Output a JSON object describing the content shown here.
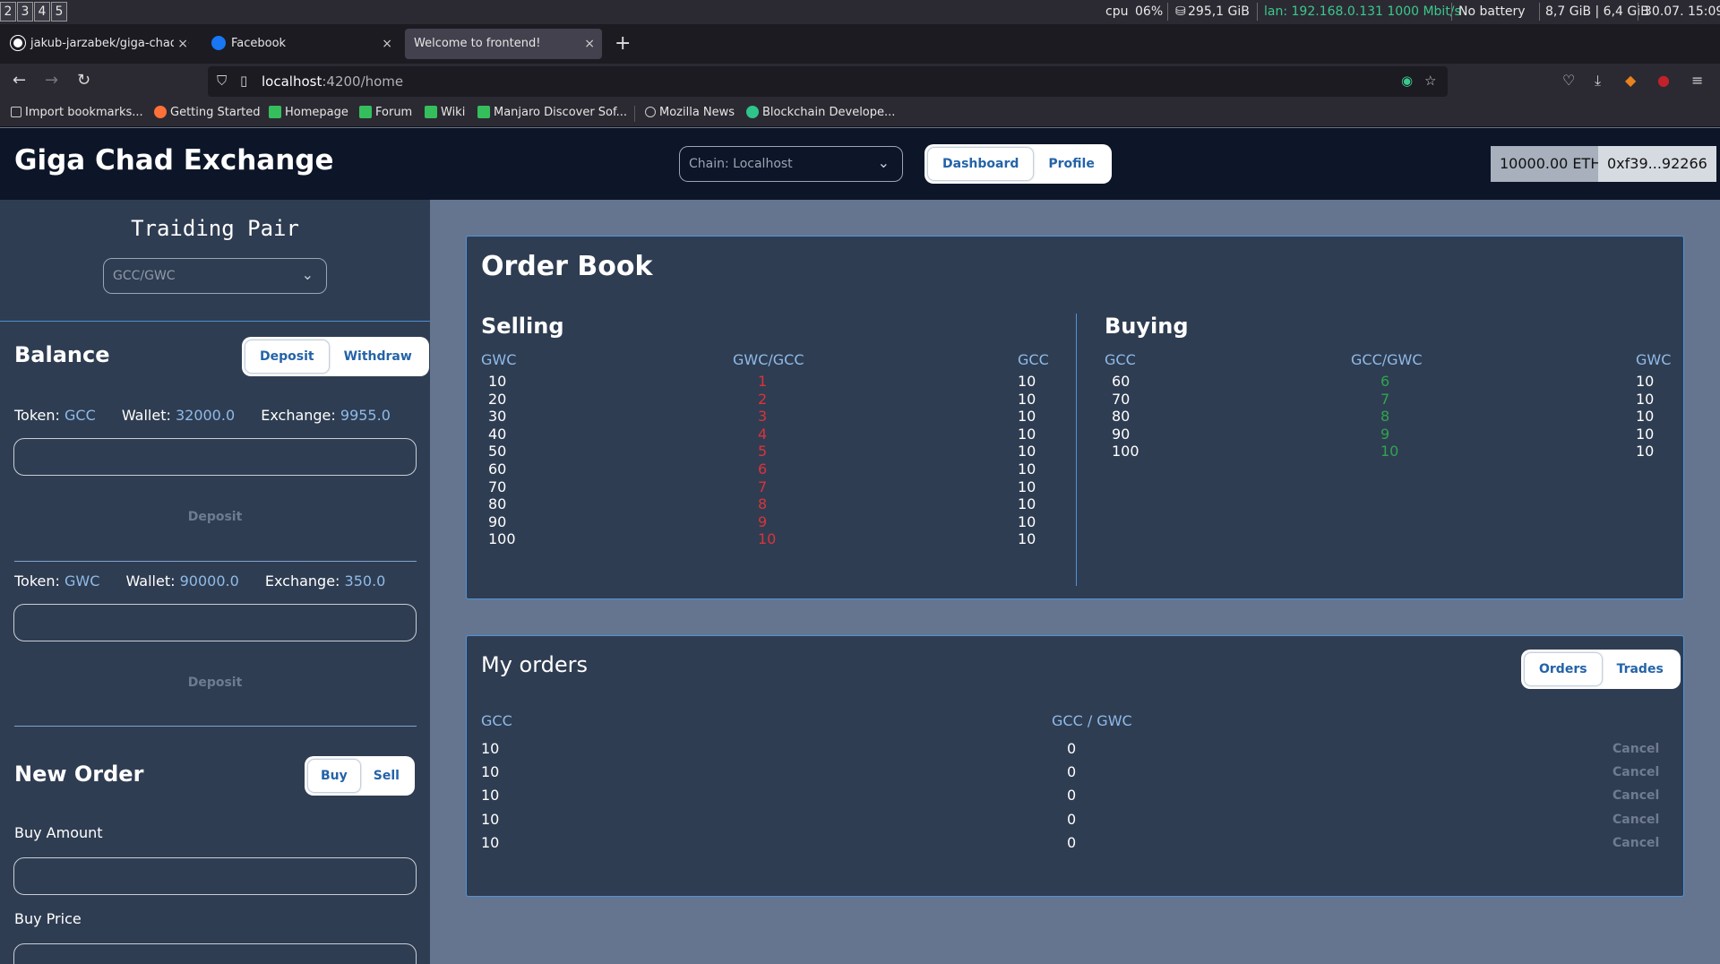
{
  "system_bar": {
    "workspaces": [
      "2",
      "3",
      "4",
      "5"
    ],
    "cpu_label": "cpu",
    "cpu_value": "06%",
    "disk": "295,1 GiB",
    "lan": "lan: 192.168.0.131 1000 Mbit/s",
    "battery": "No battery",
    "mem": "8,7 GiB | 6,4 GiB",
    "datetime": "30.07. 15:09"
  },
  "browser": {
    "tabs": [
      {
        "title": "jakub-jarzabek/giga-chad-e",
        "close": "×"
      },
      {
        "title": "Facebook",
        "close": "×"
      },
      {
        "title": "Welcome to frontend!",
        "close": "×"
      }
    ],
    "new_tab": "+",
    "url_host": "localhost",
    "url_path": ":4200/home",
    "bookmarks": [
      "Import bookmarks...",
      "Getting Started",
      "Homepage",
      "Forum",
      "Wiki",
      "Manjaro Discover Sof...",
      "Mozilla News",
      "Blockchain Develope..."
    ]
  },
  "header": {
    "title": "Giga Chad Exchange",
    "chain_select": "Chain: Localhost",
    "nav": {
      "dashboard": "Dashboard",
      "profile": "Profile"
    },
    "eth_balance": "10000.00 ETH",
    "address": "0xf39...92266"
  },
  "sidebar": {
    "pair_title": "Traiding Pair",
    "pair_select": "GCC/GWC",
    "balance": {
      "title": "Balance",
      "deposit_tab": "Deposit",
      "withdraw_tab": "Withdraw",
      "token_label": "Token:",
      "wallet_label": "Wallet:",
      "exchange_label": "Exchange:",
      "tokens": [
        {
          "token": "GCC",
          "wallet": "32000.0",
          "exchange": "9955.0",
          "button": "Deposit"
        },
        {
          "token": "GWC",
          "wallet": "90000.0",
          "exchange": "350.0",
          "button": "Deposit"
        }
      ]
    },
    "new_order": {
      "title": "New Order",
      "buy_tab": "Buy",
      "sell_tab": "Sell",
      "amount_label": "Buy Amount",
      "price_label": "Buy Price"
    }
  },
  "order_book": {
    "title": "Order Book",
    "selling": {
      "title": "Selling",
      "headers": [
        "GWC",
        "GWC/GCC",
        "GCC"
      ],
      "rows": [
        [
          "10",
          "1",
          "10"
        ],
        [
          "20",
          "2",
          "10"
        ],
        [
          "30",
          "3",
          "10"
        ],
        [
          "40",
          "4",
          "10"
        ],
        [
          "50",
          "5",
          "10"
        ],
        [
          "60",
          "6",
          "10"
        ],
        [
          "70",
          "7",
          "10"
        ],
        [
          "80",
          "8",
          "10"
        ],
        [
          "90",
          "9",
          "10"
        ],
        [
          "100",
          "10",
          "10"
        ]
      ]
    },
    "buying": {
      "title": "Buying",
      "headers": [
        "GCC",
        "GCC/GWC",
        "GWC"
      ],
      "rows": [
        [
          "60",
          "6",
          "10"
        ],
        [
          "70",
          "7",
          "10"
        ],
        [
          "80",
          "8",
          "10"
        ],
        [
          "90",
          "9",
          "10"
        ],
        [
          "100",
          "10",
          "10"
        ]
      ]
    }
  },
  "my_orders": {
    "title": "My orders",
    "orders_tab": "Orders",
    "trades_tab": "Trades",
    "headers": [
      "GCC",
      "GCC / GWC"
    ],
    "cancel_label": "Cancel",
    "rows": [
      [
        "10",
        "0"
      ],
      [
        "10",
        "0"
      ],
      [
        "10",
        "0"
      ],
      [
        "10",
        "0"
      ],
      [
        "10",
        "0"
      ]
    ]
  },
  "colors": {
    "app_header_bg": "#0d1628",
    "panel_bg": "#2f3d52",
    "page_bg": "#65758f",
    "accent_blue": "#8fbbe8",
    "sell_red": "#d9343a",
    "buy_green": "#2fa44f"
  }
}
